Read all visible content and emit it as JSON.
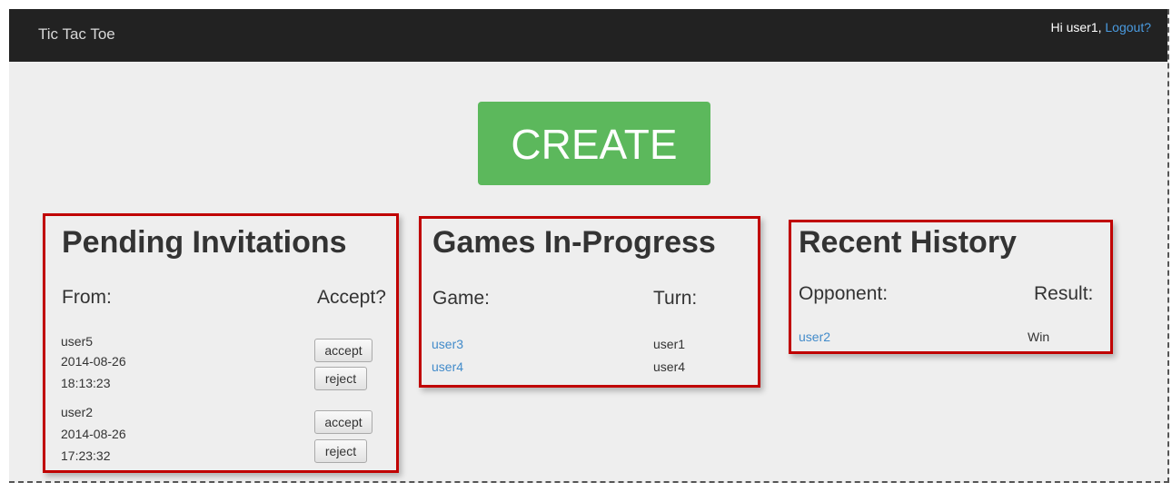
{
  "navbar": {
    "brand": "Tic Tac Toe",
    "greeting": "Hi user1, ",
    "logout_label": "Logout?"
  },
  "create_button": {
    "label": "CREATE"
  },
  "pending": {
    "title": "Pending Invitations",
    "col_from": "From:",
    "col_accept": "Accept?",
    "rows": [
      {
        "user": "user5",
        "date": "2014-08-26",
        "time": "18:13:23",
        "accept_label": "accept",
        "reject_label": "reject"
      },
      {
        "user": "user2",
        "date": "2014-08-26",
        "time": "17:23:32",
        "accept_label": "accept",
        "reject_label": "reject"
      }
    ]
  },
  "games": {
    "title": "Games In-Progress",
    "col_game": "Game:",
    "col_turn": "Turn:",
    "rows": [
      {
        "game": "user3",
        "turn": "user1"
      },
      {
        "game": "user4",
        "turn": "user4"
      }
    ]
  },
  "history": {
    "title": "Recent History",
    "col_opponent": "Opponent:",
    "col_result": "Result:",
    "rows": [
      {
        "opponent": "user2",
        "result": "Win"
      }
    ]
  },
  "colors": {
    "navbar": "#222222",
    "create": "#5cb85c",
    "highlight_border": "#c00000",
    "link": "#428bca"
  }
}
